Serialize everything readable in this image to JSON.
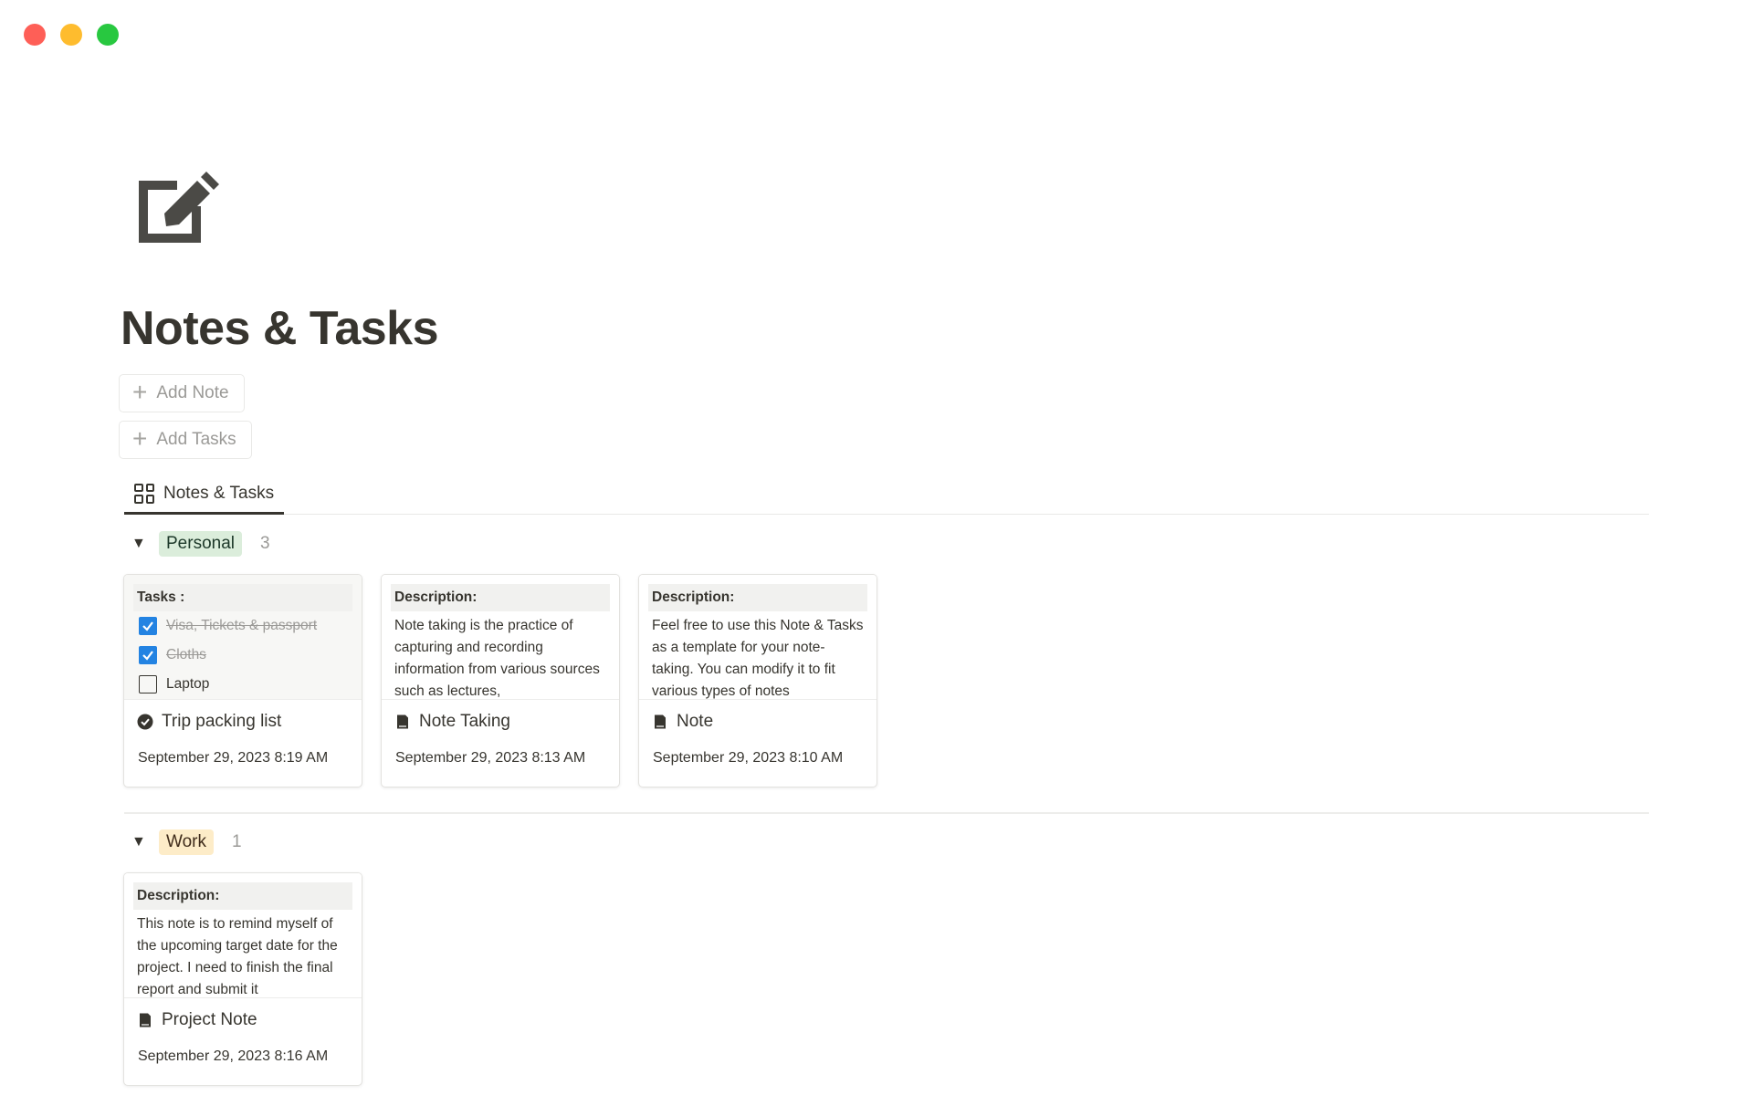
{
  "page": {
    "title": "Notes & Tasks",
    "icon": "edit-note-icon"
  },
  "actions": {
    "add_note": "Add Note",
    "add_tasks": "Add Tasks"
  },
  "views": {
    "active_tab": "Notes & Tasks",
    "tab_icon": "gallery-view-icon"
  },
  "groups": [
    {
      "name": "Personal",
      "count": "3",
      "color": "#dbeddb",
      "cards": [
        {
          "preview_label": "Tasks :",
          "todos": [
            {
              "text": "Visa, Tickets & passport",
              "checked": true
            },
            {
              "text": "Cloths",
              "checked": true
            },
            {
              "text": "Laptop",
              "checked": false
            }
          ],
          "title": "Trip packing list",
          "icon": "check-circle-icon",
          "date": "September 29, 2023 8:19 AM"
        },
        {
          "preview_label": "Description:",
          "preview_text": "Note taking is the practice of capturing and recording information from various sources such as lectures,",
          "title": "Note Taking",
          "icon": "document-icon",
          "date": "September 29, 2023 8:13 AM"
        },
        {
          "preview_label": "Description:",
          "preview_text": "Feel free to use this Note & Tasks as a template for your note-taking. You can modify it to fit various types of notes",
          "title": "Note",
          "icon": "document-icon",
          "date": "September 29, 2023 8:10 AM"
        }
      ]
    },
    {
      "name": "Work",
      "count": "1",
      "color": "#fdecc8",
      "cards": [
        {
          "preview_label": "Description:",
          "preview_text": "This note is to remind myself of the upcoming target date for the project. I need to finish the final report and submit it",
          "title": "Project Note",
          "icon": "document-icon",
          "date": "September 29, 2023 8:16 AM"
        }
      ]
    }
  ],
  "colors": {
    "checkbox_checked": "#2383e2",
    "text": "#37352f",
    "muted": "#9b9a97"
  }
}
